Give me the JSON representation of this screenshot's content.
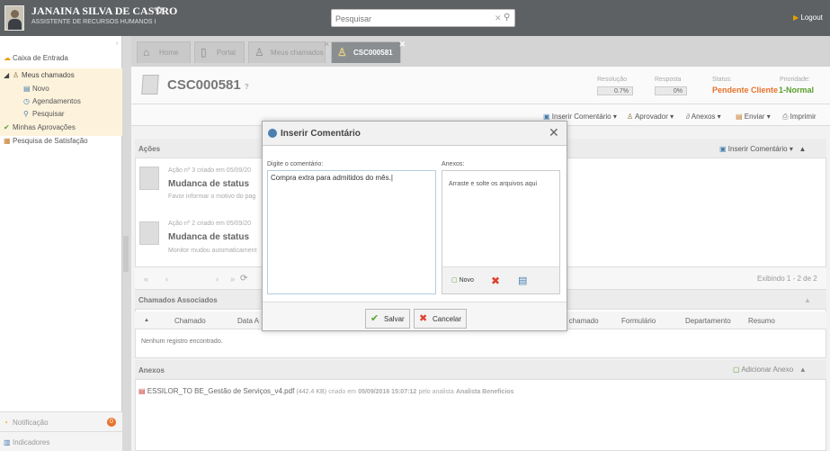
{
  "user": {
    "name": "JANAINA SILVA DE CASTRO",
    "role": "ASSISTENTE DE RECURSOS HUMANOS I"
  },
  "search": {
    "placeholder": "Pesquisar"
  },
  "logout_label": "Logout",
  "sidebar": {
    "inbox": "Caixa de Entrada",
    "my_calls": "Meus chamados",
    "new": "Novo",
    "scheduled": "Agendamentos",
    "search": "Pesquisar",
    "approvals": "Minhas Aprovações",
    "survey": "Pesquisa de Satisfação",
    "notification": "Notificação",
    "notification_count": "0",
    "indicators": "Indicadores"
  },
  "tabs": [
    {
      "label": "Home"
    },
    {
      "label": "Portal"
    },
    {
      "label": "Meus chamados"
    },
    {
      "label": "CSC000581"
    }
  ],
  "ticket": {
    "id": "CSC000581",
    "resolution_label": "Resolução",
    "resolution_value": "0.7%",
    "response_label": "Resposta",
    "response_value": "0%",
    "status_label": "Status:",
    "status_value": "Pendente Cliente",
    "priority_label": "Prioridade:",
    "priority_value": "1-Normal"
  },
  "toolbar": {
    "insert_comment": "Inserir Comentário",
    "approver": "Aprovador",
    "attachments": "Anexos",
    "send": "Enviar",
    "print": "Imprimir"
  },
  "actions": {
    "title": "Ações",
    "insert_comment": "Inserir Comentário",
    "items": [
      {
        "meta": "Ação nº 3 criado em 05/09/20",
        "title": "Mudanca de status",
        "sub": "Favor informar o motivo do pag"
      },
      {
        "meta": "Ação nº 2 criado em 05/09/20",
        "title": "Mudanca de status",
        "sub": "Monitor mudou automaticament"
      }
    ],
    "paging": "Exibindo 1 - 2 de 2"
  },
  "associated": {
    "title": "Chamados Associados",
    "columns": [
      "Chamado",
      "Data A",
      "o chamado",
      "Formulário",
      "Departamento",
      "Resumo"
    ],
    "empty": "Nenhum registro encontrado."
  },
  "attachments": {
    "title": "Anexos",
    "add": "Adicionar Anexo",
    "file": "ESSILOR_TO BE_Gestão de Serviços_v4.pdf",
    "size": "(442.4 KB)",
    "created_prefix": "criado em",
    "created_date": "05/09/2016 15:07:12",
    "by_prefix": "pelo analista",
    "analyst": "Analista Beneficios"
  },
  "dialog": {
    "title": "Inserir Comentário",
    "comment_label": "Digite o comentário:",
    "comment_value": "Compra extra para admitidos do mês.",
    "attachments_label": "Anexos:",
    "drop_text": "Arraste e solte os arquivos aqui",
    "new_label": "Novo",
    "save_label": "Salvar",
    "cancel_label": "Cancelar"
  }
}
